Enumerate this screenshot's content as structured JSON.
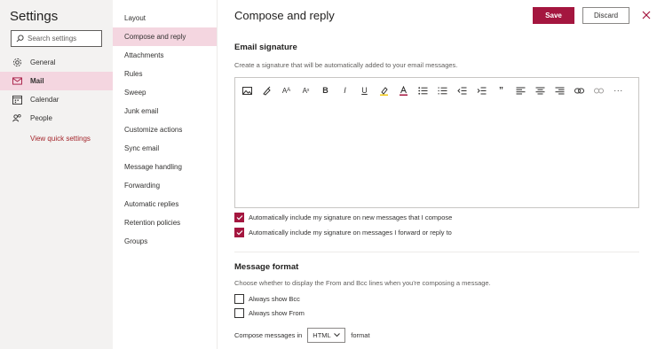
{
  "sidebar": {
    "title": "Settings",
    "search_placeholder": "Search settings",
    "items": [
      {
        "label": "General",
        "icon": "gear-icon"
      },
      {
        "label": "Mail",
        "icon": "mail-icon",
        "selected": true
      },
      {
        "label": "Calendar",
        "icon": "calendar-icon"
      },
      {
        "label": "People",
        "icon": "people-icon"
      }
    ],
    "quick_settings_label": "View quick settings"
  },
  "submenu": {
    "items": [
      {
        "label": "Layout"
      },
      {
        "label": "Compose and reply",
        "selected": true
      },
      {
        "label": "Attachments"
      },
      {
        "label": "Rules"
      },
      {
        "label": "Sweep"
      },
      {
        "label": "Junk email"
      },
      {
        "label": "Customize actions"
      },
      {
        "label": "Sync email"
      },
      {
        "label": "Message handling"
      },
      {
        "label": "Forwarding"
      },
      {
        "label": "Automatic replies"
      },
      {
        "label": "Retention policies"
      },
      {
        "label": "Groups"
      }
    ]
  },
  "main": {
    "title": "Compose and reply",
    "save_label": "Save",
    "discard_label": "Discard",
    "signature": {
      "title": "Email signature",
      "description": "Create a signature that will be automatically added to your email messages.",
      "toolbar": [
        "image-icon",
        "format-painter-icon",
        "font-size-icon",
        "superscript-icon",
        "bold-icon",
        "italic-icon",
        "underline-icon",
        "highlight-icon",
        "font-color-icon",
        "bullets-icon",
        "numbering-icon",
        "decrease-indent-icon",
        "increase-indent-icon",
        "quote-icon",
        "align-left-icon",
        "align-center-icon",
        "align-right-icon",
        "link-icon",
        "unlink-icon",
        "more-icon"
      ],
      "options": [
        {
          "label": "Automatically include my signature on new messages that I compose",
          "checked": true
        },
        {
          "label": "Automatically include my signature on messages I forward or reply to",
          "checked": true
        }
      ]
    },
    "format": {
      "title": "Message format",
      "description": "Choose whether to display the From and Bcc lines when you're composing a message.",
      "options": [
        {
          "label": "Always show Bcc",
          "checked": false
        },
        {
          "label": "Always show From",
          "checked": false
        }
      ],
      "compose_prefix": "Compose messages in",
      "compose_value": "HTML",
      "compose_suffix": "format"
    }
  },
  "colors": {
    "accent": "#a4163f",
    "selected_bg": "#f4d6e0",
    "left_bg": "#f3f2f1"
  }
}
